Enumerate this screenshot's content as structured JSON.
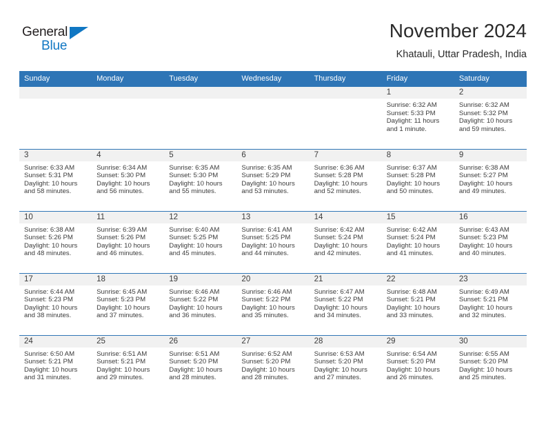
{
  "brand": {
    "name_part1": "General",
    "name_part2": "Blue",
    "logo_icon": "triangle-logo-icon",
    "accent_color": "#1077c3"
  },
  "header": {
    "title": "November 2024",
    "subtitle": "Khatauli, Uttar Pradesh, India"
  },
  "calendar": {
    "header_color": "#2e75b6",
    "daynum_band_color": "#f1f1f1",
    "weekday_headers": [
      "Sunday",
      "Monday",
      "Tuesday",
      "Wednesday",
      "Thursday",
      "Friday",
      "Saturday"
    ],
    "weeks": [
      [
        {
          "day": "",
          "sunrise": "",
          "sunset": "",
          "daylight_line1": "",
          "daylight_line2": ""
        },
        {
          "day": "",
          "sunrise": "",
          "sunset": "",
          "daylight_line1": "",
          "daylight_line2": ""
        },
        {
          "day": "",
          "sunrise": "",
          "sunset": "",
          "daylight_line1": "",
          "daylight_line2": ""
        },
        {
          "day": "",
          "sunrise": "",
          "sunset": "",
          "daylight_line1": "",
          "daylight_line2": ""
        },
        {
          "day": "",
          "sunrise": "",
          "sunset": "",
          "daylight_line1": "",
          "daylight_line2": ""
        },
        {
          "day": "1",
          "sunrise": "Sunrise: 6:32 AM",
          "sunset": "Sunset: 5:33 PM",
          "daylight_line1": "Daylight: 11 hours",
          "daylight_line2": "and 1 minute."
        },
        {
          "day": "2",
          "sunrise": "Sunrise: 6:32 AM",
          "sunset": "Sunset: 5:32 PM",
          "daylight_line1": "Daylight: 10 hours",
          "daylight_line2": "and 59 minutes."
        }
      ],
      [
        {
          "day": "3",
          "sunrise": "Sunrise: 6:33 AM",
          "sunset": "Sunset: 5:31 PM",
          "daylight_line1": "Daylight: 10 hours",
          "daylight_line2": "and 58 minutes."
        },
        {
          "day": "4",
          "sunrise": "Sunrise: 6:34 AM",
          "sunset": "Sunset: 5:30 PM",
          "daylight_line1": "Daylight: 10 hours",
          "daylight_line2": "and 56 minutes."
        },
        {
          "day": "5",
          "sunrise": "Sunrise: 6:35 AM",
          "sunset": "Sunset: 5:30 PM",
          "daylight_line1": "Daylight: 10 hours",
          "daylight_line2": "and 55 minutes."
        },
        {
          "day": "6",
          "sunrise": "Sunrise: 6:35 AM",
          "sunset": "Sunset: 5:29 PM",
          "daylight_line1": "Daylight: 10 hours",
          "daylight_line2": "and 53 minutes."
        },
        {
          "day": "7",
          "sunrise": "Sunrise: 6:36 AM",
          "sunset": "Sunset: 5:28 PM",
          "daylight_line1": "Daylight: 10 hours",
          "daylight_line2": "and 52 minutes."
        },
        {
          "day": "8",
          "sunrise": "Sunrise: 6:37 AM",
          "sunset": "Sunset: 5:28 PM",
          "daylight_line1": "Daylight: 10 hours",
          "daylight_line2": "and 50 minutes."
        },
        {
          "day": "9",
          "sunrise": "Sunrise: 6:38 AM",
          "sunset": "Sunset: 5:27 PM",
          "daylight_line1": "Daylight: 10 hours",
          "daylight_line2": "and 49 minutes."
        }
      ],
      [
        {
          "day": "10",
          "sunrise": "Sunrise: 6:38 AM",
          "sunset": "Sunset: 5:26 PM",
          "daylight_line1": "Daylight: 10 hours",
          "daylight_line2": "and 48 minutes."
        },
        {
          "day": "11",
          "sunrise": "Sunrise: 6:39 AM",
          "sunset": "Sunset: 5:26 PM",
          "daylight_line1": "Daylight: 10 hours",
          "daylight_line2": "and 46 minutes."
        },
        {
          "day": "12",
          "sunrise": "Sunrise: 6:40 AM",
          "sunset": "Sunset: 5:25 PM",
          "daylight_line1": "Daylight: 10 hours",
          "daylight_line2": "and 45 minutes."
        },
        {
          "day": "13",
          "sunrise": "Sunrise: 6:41 AM",
          "sunset": "Sunset: 5:25 PM",
          "daylight_line1": "Daylight: 10 hours",
          "daylight_line2": "and 44 minutes."
        },
        {
          "day": "14",
          "sunrise": "Sunrise: 6:42 AM",
          "sunset": "Sunset: 5:24 PM",
          "daylight_line1": "Daylight: 10 hours",
          "daylight_line2": "and 42 minutes."
        },
        {
          "day": "15",
          "sunrise": "Sunrise: 6:42 AM",
          "sunset": "Sunset: 5:24 PM",
          "daylight_line1": "Daylight: 10 hours",
          "daylight_line2": "and 41 minutes."
        },
        {
          "day": "16",
          "sunrise": "Sunrise: 6:43 AM",
          "sunset": "Sunset: 5:23 PM",
          "daylight_line1": "Daylight: 10 hours",
          "daylight_line2": "and 40 minutes."
        }
      ],
      [
        {
          "day": "17",
          "sunrise": "Sunrise: 6:44 AM",
          "sunset": "Sunset: 5:23 PM",
          "daylight_line1": "Daylight: 10 hours",
          "daylight_line2": "and 38 minutes."
        },
        {
          "day": "18",
          "sunrise": "Sunrise: 6:45 AM",
          "sunset": "Sunset: 5:23 PM",
          "daylight_line1": "Daylight: 10 hours",
          "daylight_line2": "and 37 minutes."
        },
        {
          "day": "19",
          "sunrise": "Sunrise: 6:46 AM",
          "sunset": "Sunset: 5:22 PM",
          "daylight_line1": "Daylight: 10 hours",
          "daylight_line2": "and 36 minutes."
        },
        {
          "day": "20",
          "sunrise": "Sunrise: 6:46 AM",
          "sunset": "Sunset: 5:22 PM",
          "daylight_line1": "Daylight: 10 hours",
          "daylight_line2": "and 35 minutes."
        },
        {
          "day": "21",
          "sunrise": "Sunrise: 6:47 AM",
          "sunset": "Sunset: 5:22 PM",
          "daylight_line1": "Daylight: 10 hours",
          "daylight_line2": "and 34 minutes."
        },
        {
          "day": "22",
          "sunrise": "Sunrise: 6:48 AM",
          "sunset": "Sunset: 5:21 PM",
          "daylight_line1": "Daylight: 10 hours",
          "daylight_line2": "and 33 minutes."
        },
        {
          "day": "23",
          "sunrise": "Sunrise: 6:49 AM",
          "sunset": "Sunset: 5:21 PM",
          "daylight_line1": "Daylight: 10 hours",
          "daylight_line2": "and 32 minutes."
        }
      ],
      [
        {
          "day": "24",
          "sunrise": "Sunrise: 6:50 AM",
          "sunset": "Sunset: 5:21 PM",
          "daylight_line1": "Daylight: 10 hours",
          "daylight_line2": "and 31 minutes."
        },
        {
          "day": "25",
          "sunrise": "Sunrise: 6:51 AM",
          "sunset": "Sunset: 5:21 PM",
          "daylight_line1": "Daylight: 10 hours",
          "daylight_line2": "and 29 minutes."
        },
        {
          "day": "26",
          "sunrise": "Sunrise: 6:51 AM",
          "sunset": "Sunset: 5:20 PM",
          "daylight_line1": "Daylight: 10 hours",
          "daylight_line2": "and 28 minutes."
        },
        {
          "day": "27",
          "sunrise": "Sunrise: 6:52 AM",
          "sunset": "Sunset: 5:20 PM",
          "daylight_line1": "Daylight: 10 hours",
          "daylight_line2": "and 28 minutes."
        },
        {
          "day": "28",
          "sunrise": "Sunrise: 6:53 AM",
          "sunset": "Sunset: 5:20 PM",
          "daylight_line1": "Daylight: 10 hours",
          "daylight_line2": "and 27 minutes."
        },
        {
          "day": "29",
          "sunrise": "Sunrise: 6:54 AM",
          "sunset": "Sunset: 5:20 PM",
          "daylight_line1": "Daylight: 10 hours",
          "daylight_line2": "and 26 minutes."
        },
        {
          "day": "30",
          "sunrise": "Sunrise: 6:55 AM",
          "sunset": "Sunset: 5:20 PM",
          "daylight_line1": "Daylight: 10 hours",
          "daylight_line2": "and 25 minutes."
        }
      ]
    ]
  }
}
